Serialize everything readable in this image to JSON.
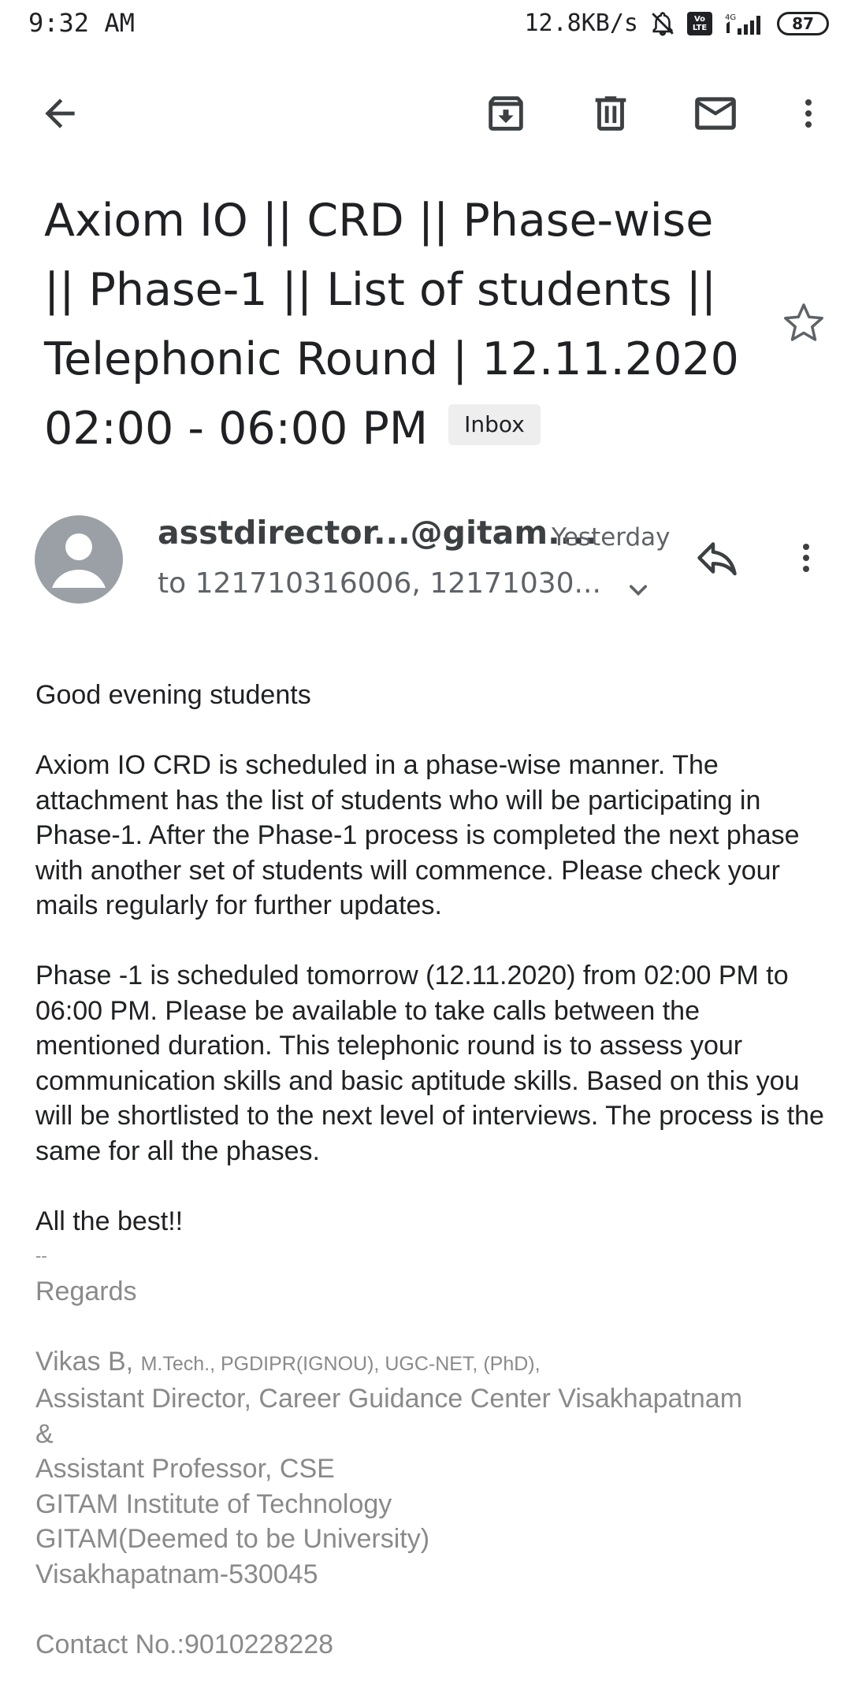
{
  "status_bar": {
    "time": "9:32 AM",
    "speed": "12.8KB/s",
    "battery": "87",
    "network": "4G"
  },
  "toolbar": {
    "icons": [
      "back-arrow-icon",
      "archive-icon",
      "delete-icon",
      "mark-unread-icon",
      "more-vert-icon"
    ]
  },
  "email": {
    "subject": "Axiom IO || CRD || Phase-wise || Phase-1 || List of students || Telephonic Round | 12.11.2020 02:00 - 06:00 PM",
    "label": "Inbox",
    "starred": false,
    "sender": "asstdirector...@gitam....",
    "date": "Yesterday",
    "recipients": "to 121710316006, 12171030...",
    "body": {
      "greeting": "Good evening students",
      "paragraph1": "Axiom IO CRD is scheduled in a phase-wise manner. The attachment has the list of students who will be participating in Phase-1. After the Phase-1 process is completed the next phase with another set of students will commence. Please check your mails regularly for further updates.",
      "paragraph2": "Phase -1 is scheduled tomorrow (12.11.2020) from 02:00 PM to 06:00 PM. Please be available to take calls between the mentioned duration. This telephonic round is to assess your communication skills and basic aptitude skills. Based on this you will be shortlisted to the next level of interviews. The process is the same for all the phases.",
      "closing": "All the best!!",
      "separator": "--",
      "regards": "Regards",
      "sig_name": "Vikas B,",
      "sig_credentials": "M.Tech., PGDIPR(IGNOU), UGC-NET, (PhD),",
      "sig_line1": "Assistant Director, Career Guidance Center Visakhapatnam",
      "sig_line2": "&",
      "sig_line3": "Assistant Professor, CSE",
      "sig_line4": "GITAM Institute of Technology",
      "sig_line5": "GITAM(Deemed to be University)",
      "sig_line6": "Visakhapatnam-530045",
      "contact": "Contact No.:9010228228"
    }
  }
}
